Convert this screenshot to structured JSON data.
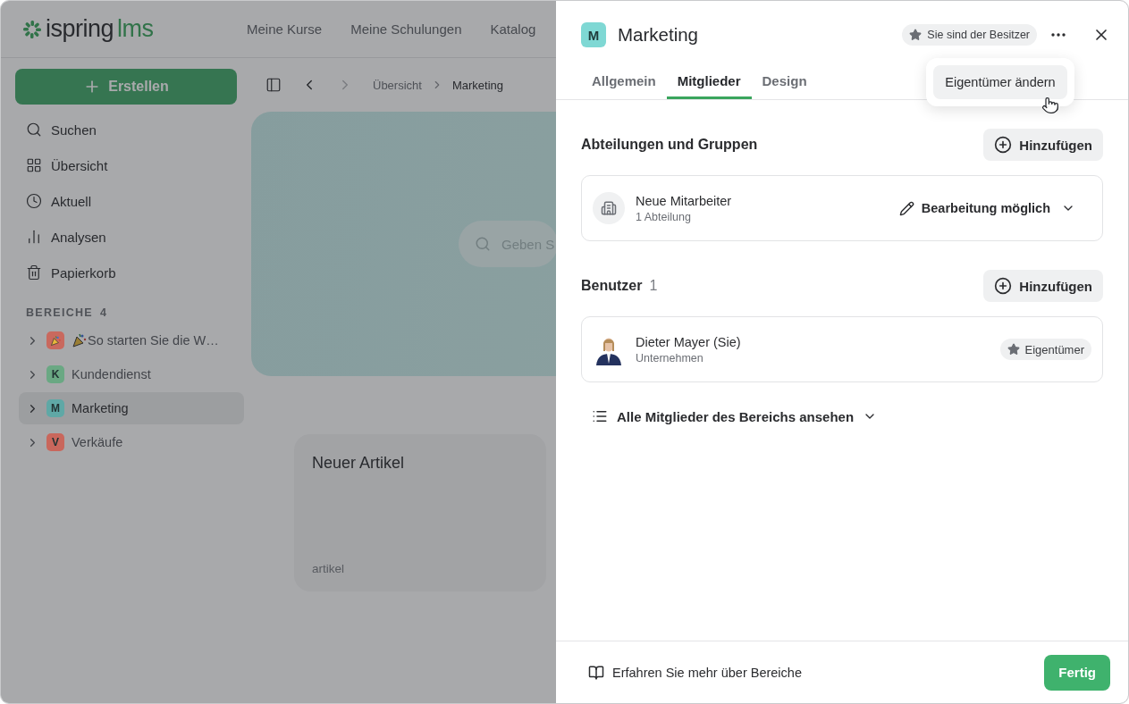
{
  "header": {
    "logo": "ispring",
    "logo_suffix": "lms",
    "nav": [
      {
        "label": "Meine Kurse"
      },
      {
        "label": "Meine Schulungen"
      },
      {
        "label": "Katalog"
      }
    ]
  },
  "sidebar": {
    "create_button": "Erstellen",
    "items": [
      {
        "label": "Suchen"
      },
      {
        "label": "Übersicht"
      },
      {
        "label": "Aktuell"
      },
      {
        "label": "Analysen"
      },
      {
        "label": "Papierkorb"
      }
    ],
    "section": {
      "title": "BEREICHE",
      "count": "4"
    },
    "spaces": [
      {
        "kind": "emoji",
        "label": "So starten Sie die W…",
        "color": "#c9695e",
        "selected": false,
        "expanded": false
      },
      {
        "kind": "letter",
        "letter": "K",
        "label": "Kundendienst",
        "color": "#6aa883",
        "selected": false,
        "expanded": false
      },
      {
        "kind": "letter",
        "letter": "M",
        "label": "Marketing",
        "color": "#5fa8a6",
        "selected": true,
        "expanded": false
      },
      {
        "kind": "letter",
        "letter": "V",
        "label": "Verkäufe",
        "color": "#c9675c",
        "selected": false,
        "expanded": false
      }
    ]
  },
  "toolbar": {
    "breadcrumbs": [
      {
        "label": "Übersicht",
        "current": false
      },
      {
        "label": "Marketing",
        "current": true
      }
    ],
    "back_disabled": false,
    "forward_disabled": true
  },
  "hero": {
    "search_placeholder": "Geben S"
  },
  "card": {
    "title": "Neuer Artikel",
    "subtitle": "artikel"
  },
  "panel": {
    "avatar": "M",
    "title": "Marketing",
    "owner_badge": "Sie sind der Besitzer",
    "menu": [
      {
        "label": "Eigentümer ändern"
      }
    ],
    "tabs": [
      {
        "label": "Allgemein",
        "selected": false
      },
      {
        "label": "Mitglieder",
        "selected": true
      },
      {
        "label": "Design",
        "selected": false
      }
    ],
    "groups": {
      "title": "Abteilungen und Gruppen",
      "add_button": "Hinzufügen",
      "items": [
        {
          "name": "Neue Mitarbeiter",
          "sub": "1 Abteilung",
          "permission": "Bearbeitung möglich"
        }
      ]
    },
    "users": {
      "title": "Benutzer",
      "count": "1",
      "add_button": "Hinzufügen",
      "items": [
        {
          "name": "Dieter Mayer (Sie)",
          "sub": "Unternehmen",
          "role": "Eigentümer"
        }
      ]
    },
    "show_all": "Alle Mitglieder des Bereichs ansehen",
    "footer": {
      "link": "Erfahren Sie mehr über Bereiche",
      "done_button": "Fertig"
    }
  }
}
